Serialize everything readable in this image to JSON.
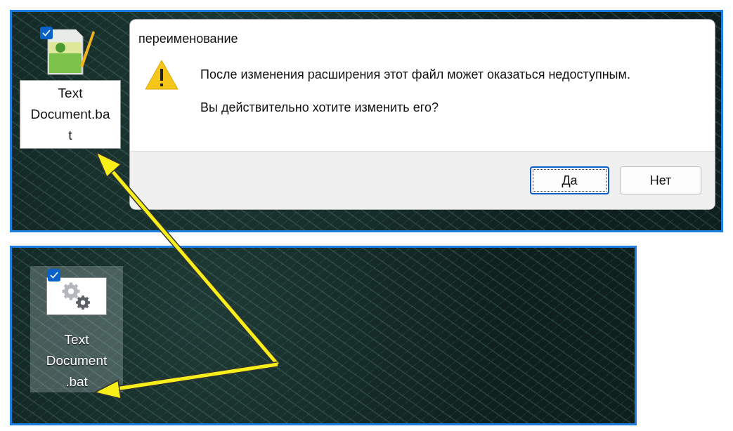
{
  "top_screen": {
    "desktop_icon": {
      "label_lines": [
        "Text",
        "Document.ba",
        "t"
      ],
      "checked": true,
      "selected": true
    },
    "dialog": {
      "title": "переименование",
      "message_lines": [
        "После изменения расширения этот файл может оказаться недоступным.",
        "Вы действительно хотите изменить его?"
      ],
      "buttons": [
        {
          "label": "Да",
          "default": true
        },
        {
          "label": "Нет",
          "default": false
        }
      ]
    }
  },
  "bottom_screen": {
    "desktop_icon": {
      "label_lines": [
        "Text",
        "Document",
        ".bat"
      ],
      "checked": true,
      "selected": true
    }
  }
}
